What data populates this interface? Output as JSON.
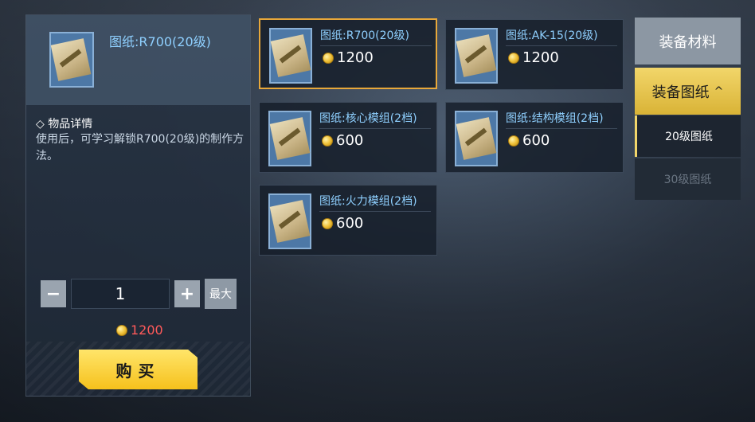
{
  "detail": {
    "title": "图纸:R700(20级)",
    "section_title": "◇ 物品详情",
    "description": "使用后，可学习解锁R700(20级)的制作方法。",
    "quantity": "1",
    "minus_label": "−",
    "plus_label": "+",
    "max_label": "最大",
    "total_price": "1200",
    "buy_label": "购买"
  },
  "items": [
    {
      "name": "图纸:R700(20级)",
      "price": "1200"
    },
    {
      "name": "图纸:AK-15(20级)",
      "price": "1200"
    },
    {
      "name": "图纸:核心模组(2档)",
      "price": "600"
    },
    {
      "name": "图纸:结构模组(2档)",
      "price": "600"
    },
    {
      "name": "图纸:火力模组(2档)",
      "price": "600"
    }
  ],
  "tabs": {
    "materials": "装备材料",
    "blueprints": "装备图纸",
    "sub_20": "20级图纸",
    "sub_30": "30级图纸"
  },
  "colors": {
    "accent_yellow": "#f6c11c",
    "selected_border": "#e8a83a",
    "item_name": "#8fd0ff",
    "price_red": "#ff5a5a"
  }
}
